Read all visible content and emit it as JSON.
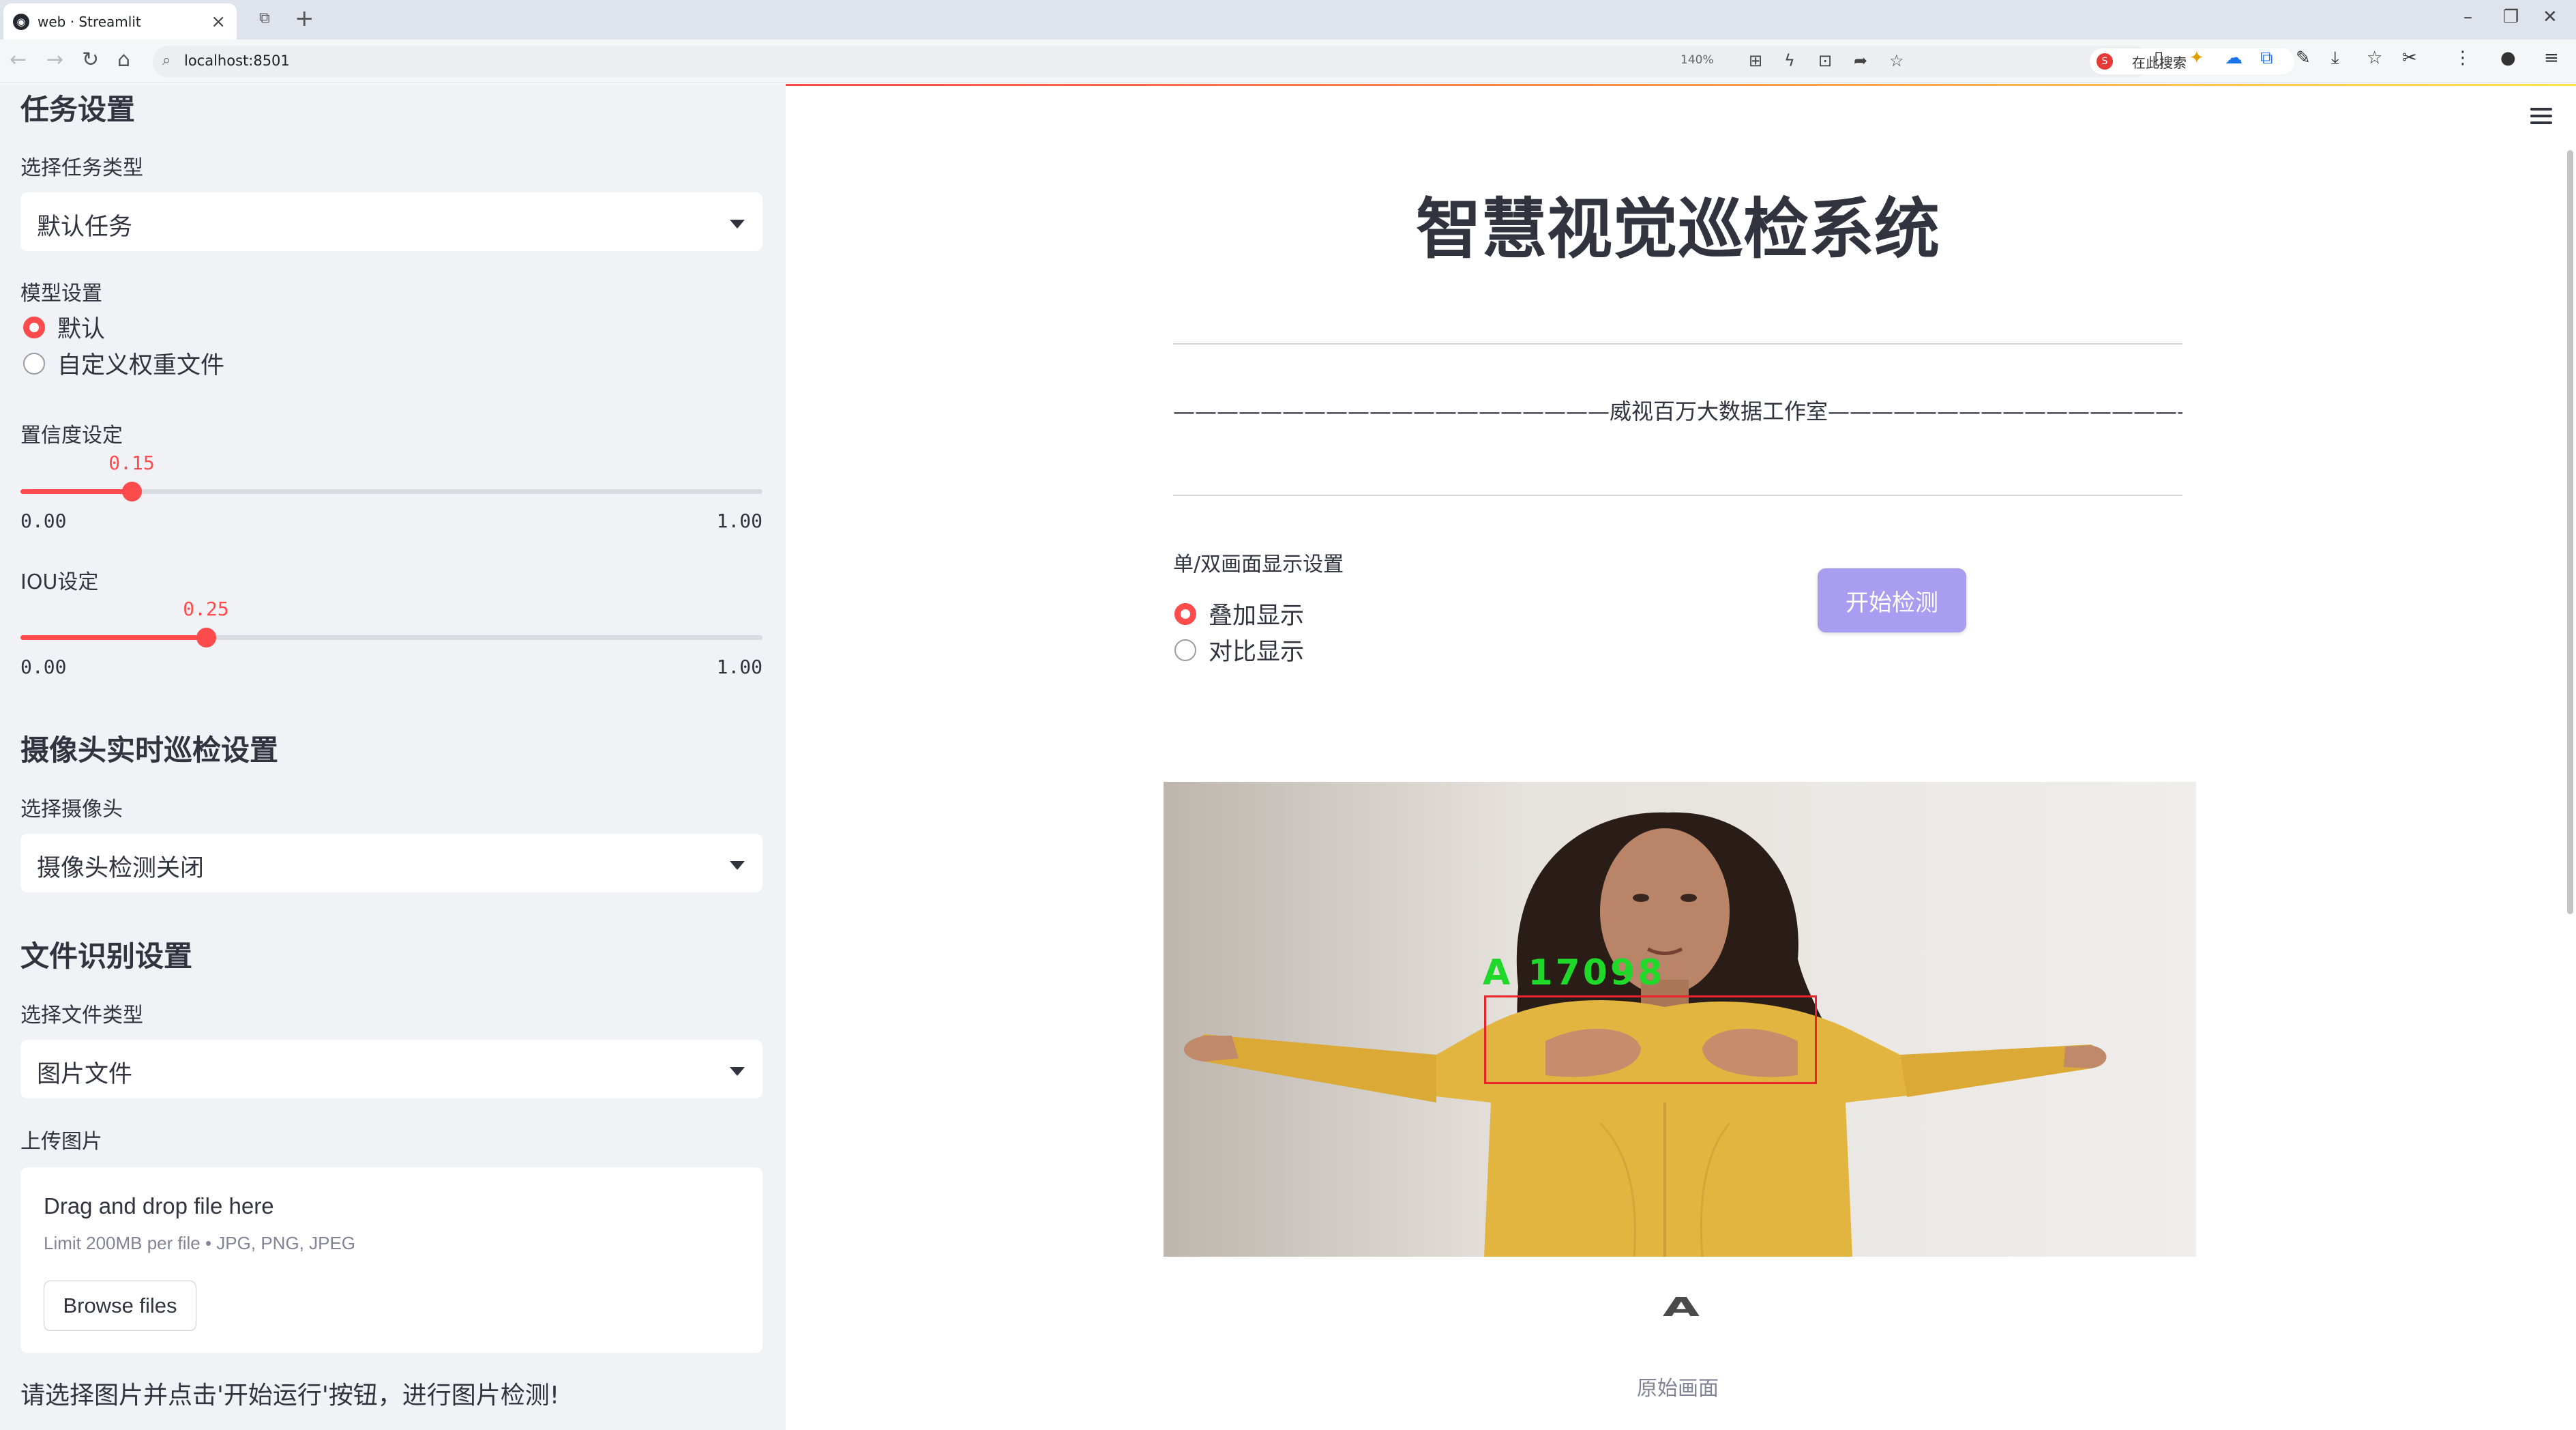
{
  "browser": {
    "tab_title": "web · Streamlit",
    "url": "localhost:8501",
    "zoom": "140%",
    "search_placeholder": "在此搜索"
  },
  "sidebar": {
    "task_heading": "任务设置",
    "task_type_label": "选择任务类型",
    "task_type_value": "默认任务",
    "model_label": "模型设置",
    "model_options": [
      "默认",
      "自定义权重文件"
    ],
    "model_selected": "默认",
    "confidence": {
      "label": "置信度设定",
      "value": "0.15",
      "min": "0.00",
      "max": "1.00",
      "fraction": 0.15
    },
    "iou": {
      "label": "IOU设定",
      "value": "0.25",
      "min": "0.00",
      "max": "1.00",
      "fraction": 0.25
    },
    "camera_heading": "摄像头实时巡检设置",
    "camera_label": "选择摄像头",
    "camera_value": "摄像头检测关闭",
    "file_heading": "文件识别设置",
    "file_type_label": "选择文件类型",
    "file_type_value": "图片文件",
    "upload_label": "上传图片",
    "upload_title": "Drag and drop file here",
    "upload_sub": "Limit 200MB per file • JPG, PNG, JPEG",
    "browse_label": "Browse files",
    "footer_hint": "请选择图片并点击'开始运行'按钮，进行图片检测!"
  },
  "main": {
    "title": "智慧视觉巡检系统",
    "studio": "————————————————————威视百万大数据工作室—————————————————————",
    "display_label": "单/双画面显示设置",
    "display_options": [
      "叠加显示",
      "对比显示"
    ],
    "display_selected": "叠加显示",
    "start_button": "开始检测",
    "detection_label": "A  17098",
    "result_letter": "A",
    "caption": "原始画面"
  },
  "colors": {
    "accent": "#ff4b4b",
    "sidebar_bg": "#f0f2f6",
    "button": "#a89df0",
    "detection_box": "#e8232a",
    "detection_text": "#1fd82a"
  }
}
